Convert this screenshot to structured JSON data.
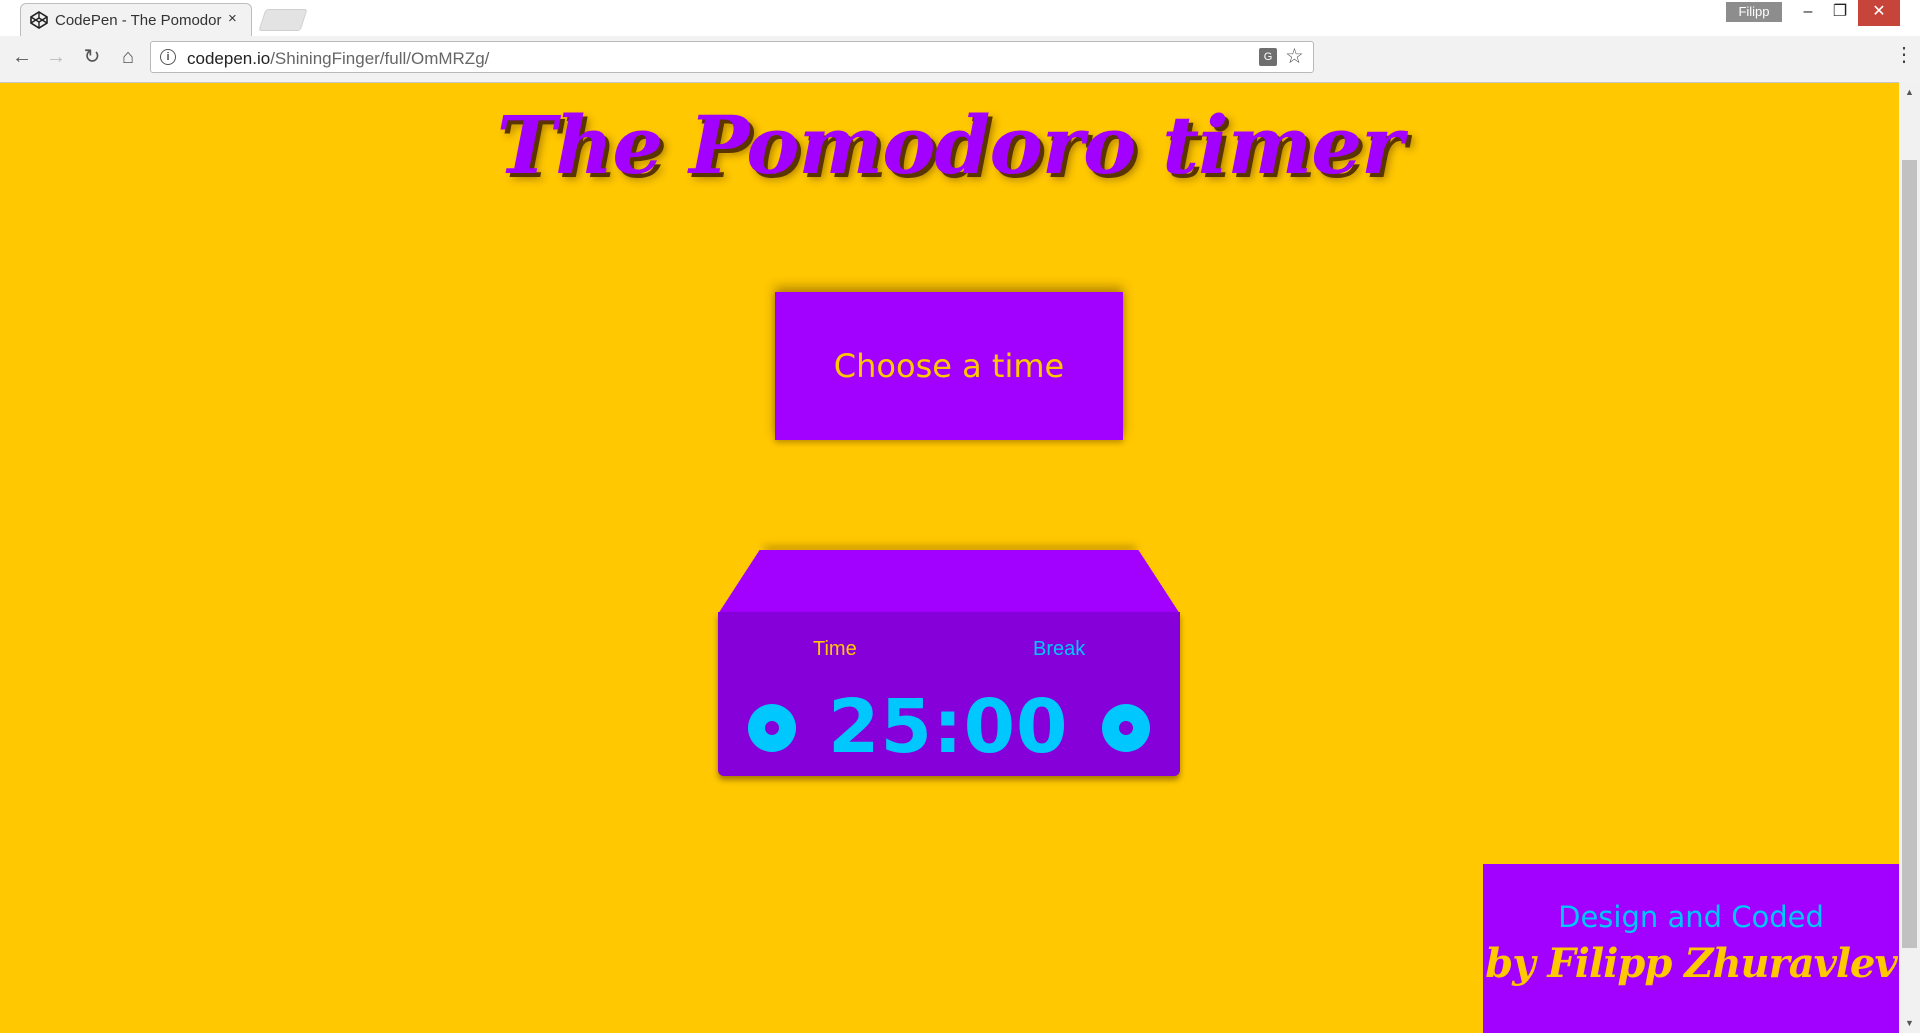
{
  "browser": {
    "tab": {
      "title": "CodePen - The Pomodor",
      "close_glyph": "×",
      "icon": "codepen-icon"
    },
    "profile_name": "Filipp",
    "window": {
      "minimize": "–",
      "maximize": "❐",
      "close": "✕"
    },
    "nav": {
      "back": "←",
      "forward": "→",
      "reload": "↻",
      "home": "⌂"
    },
    "url": {
      "host": "codepen.io",
      "path": "/ShiningFinger/full/OmMRZg/"
    },
    "icons": {
      "info": "i",
      "translate": "G",
      "star": "☆",
      "menu": "⋮"
    }
  },
  "page": {
    "title": "The Pomodoro timer",
    "choose_button": "Choose a time",
    "clock": {
      "time_label": "Time",
      "break_label": "Break",
      "display": "25:00"
    },
    "credit": {
      "line1": "Design and Coded",
      "line2": "by Filipp Zhuravlev"
    }
  },
  "colors": {
    "background": "#ffc800",
    "purple": "#a200ff",
    "dark_purple": "#8600d9",
    "cyan": "#00c8ff"
  }
}
